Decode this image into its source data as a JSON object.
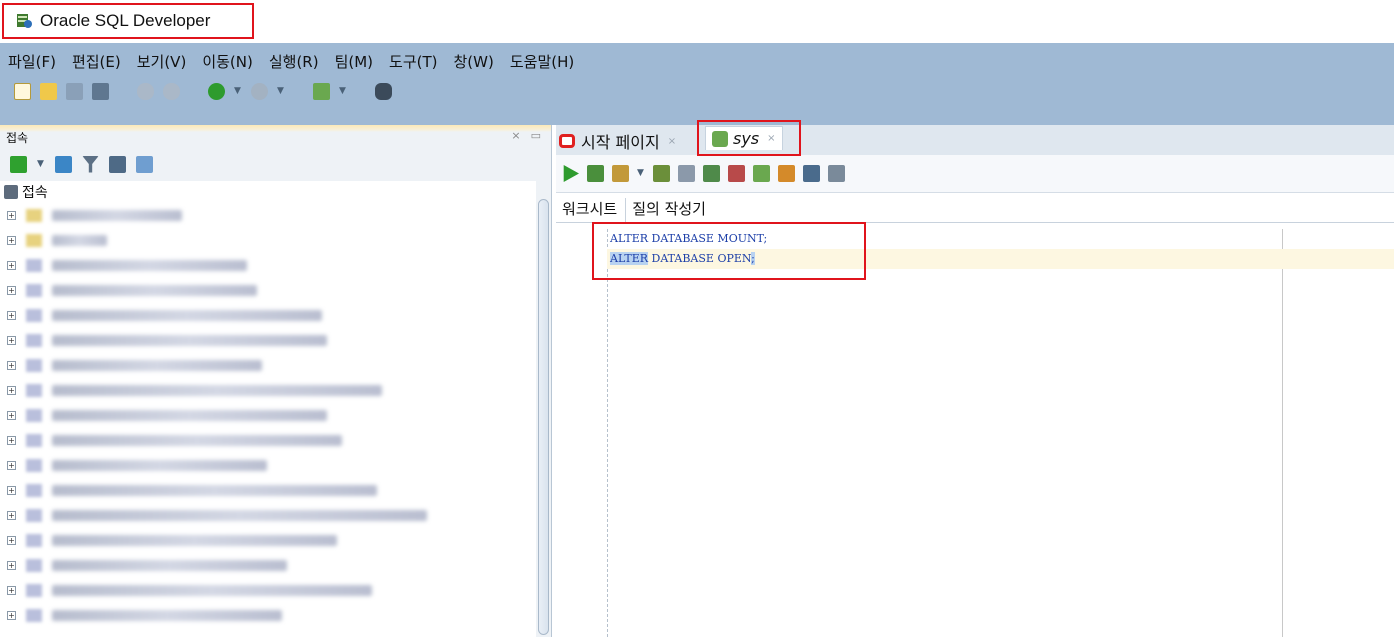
{
  "window": {
    "title": "Oracle SQL Developer"
  },
  "menu": [
    "파일(F)",
    "편집(E)",
    "보기(V)",
    "이동(N)",
    "실행(R)",
    "팀(M)",
    "도구(T)",
    "창(W)",
    "도움말(H)"
  ],
  "connections_panel": {
    "title": "접속",
    "root_label": "접속",
    "items_count_note": ""
  },
  "tabs": {
    "start_page": "시작 페이지",
    "sys": "sys"
  },
  "subtabs": {
    "worksheet": "워크시트",
    "query_builder": "질의 작성기"
  },
  "editor": {
    "line1": "ALTER DATABASE MOUNT;",
    "line2_selected": "ALTER",
    "line2_rest": " DATABASE OPEN",
    "line2_end": ";"
  },
  "colors": {
    "chrome": "#9fb9d4",
    "highlight_box": "#e0141c",
    "code": "#1d3fa8"
  }
}
